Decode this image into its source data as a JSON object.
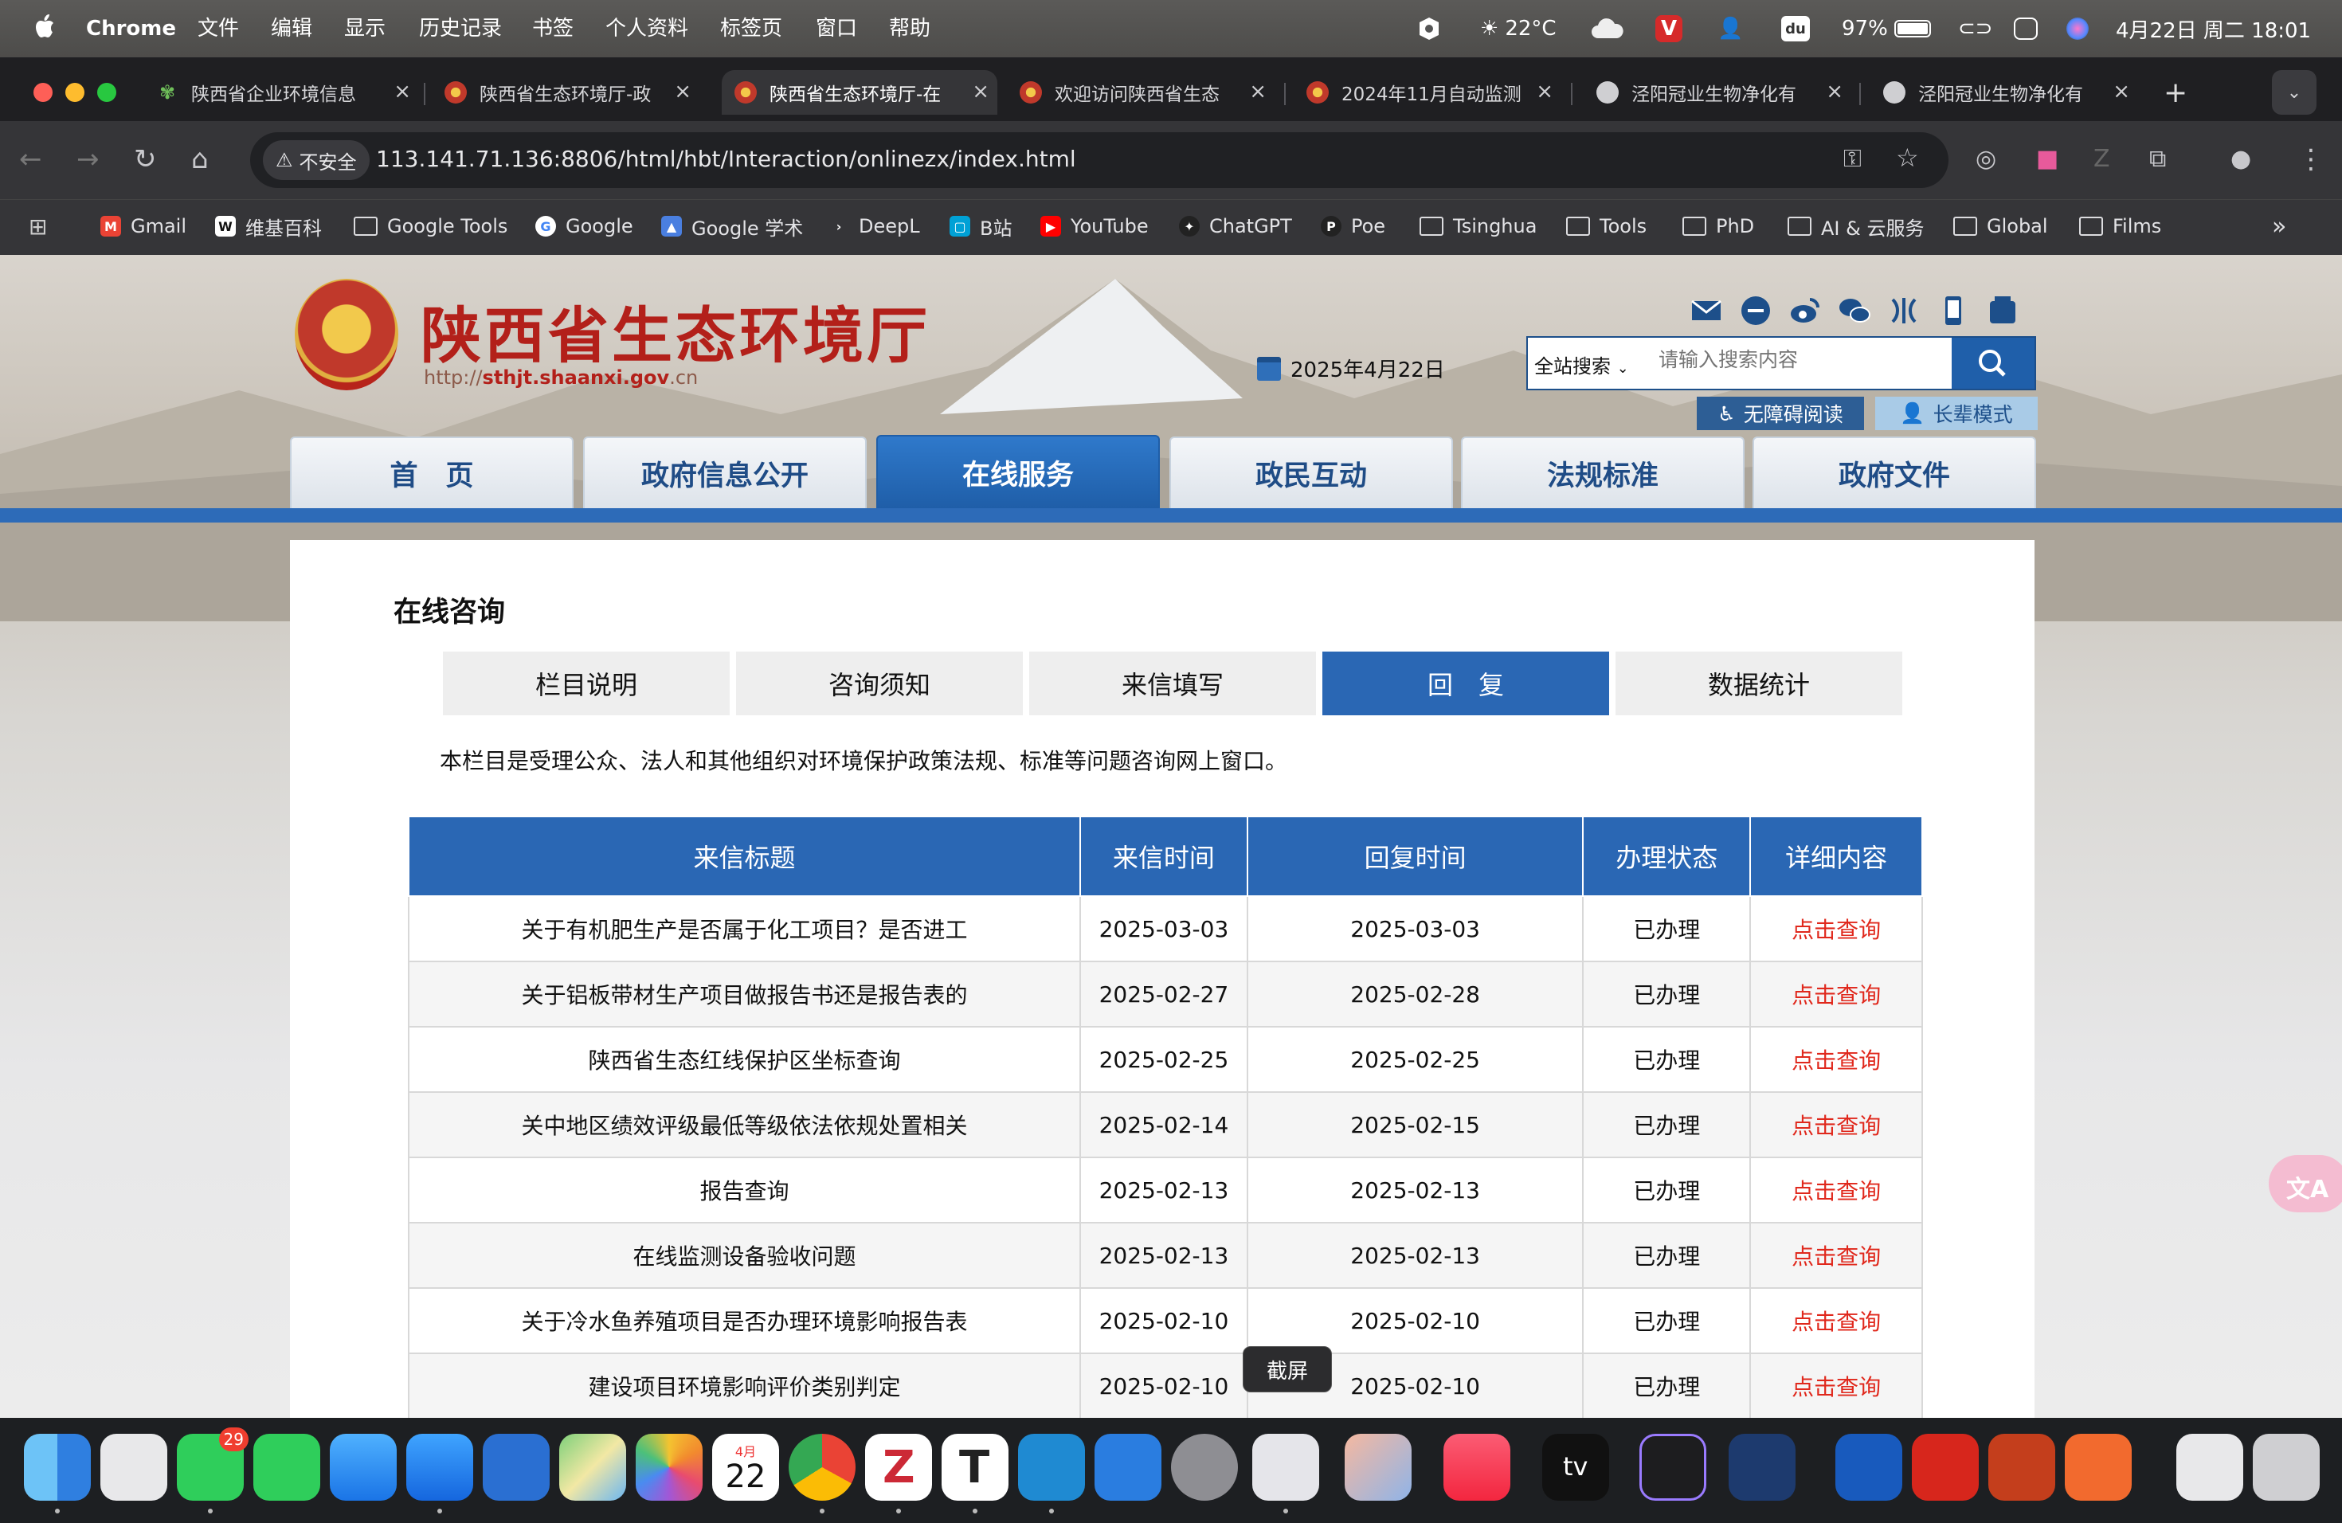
{
  "menubar": {
    "app": "Chrome",
    "items": [
      "文件",
      "编辑",
      "显示",
      "历史记录",
      "书签",
      "个人资料",
      "标签页",
      "窗口",
      "帮助"
    ],
    "weather": "22°C",
    "battery": "97%",
    "clock": "4月22日 周二  18:01"
  },
  "tabs": [
    {
      "label": "陕西省企业环境信息",
      "active": false
    },
    {
      "label": "陕西省生态环境厅-政",
      "active": false
    },
    {
      "label": "陕西省生态环境厅-在",
      "active": true
    },
    {
      "label": "欢迎访问陕西省生态",
      "active": false
    },
    {
      "label": "2024年11月自动监测",
      "active": false
    },
    {
      "label": "泾阳冠业生物净化有",
      "active": false
    },
    {
      "label": "泾阳冠业生物净化有",
      "active": false
    }
  ],
  "omnibox": {
    "security": "不安全",
    "url": "113.141.71.136:8806/html/hbt/Interaction/onlinezx/index.html"
  },
  "bookmarks": [
    "Gmail",
    "维基百科",
    "Google Tools",
    "Google",
    "Google 学术",
    "DeepL",
    "B站",
    "YouTube",
    "ChatGPT",
    "Poe",
    "Tsinghua",
    "Tools",
    "PhD",
    "AI & 云服务",
    "Global",
    "Films"
  ],
  "site": {
    "title": "陕西省生态环境厅",
    "url_prefix": "http://",
    "url_host": "sthjt.shaanxi.gov",
    "url_suffix": ".cn",
    "date": "2025年4月22日",
    "search_scope": "全站搜索",
    "search_placeholder": "请输入搜索内容",
    "accessibility": "无障碍阅读",
    "elder_mode": "长辈模式",
    "nav": [
      "首　页",
      "政府信息公开",
      "在线服务",
      "政民互动",
      "法规标准",
      "政府文件"
    ],
    "active_nav": 2
  },
  "consult": {
    "heading": "在线咨询",
    "subtabs": [
      "栏目说明",
      "咨询须知",
      "来信填写",
      "回　复",
      "数据统计"
    ],
    "active_subtab": 3,
    "description": "本栏目是受理公众、法人和其他组织对环境保护政策法规、标准等问题咨询网上窗口。",
    "columns": [
      "来信标题",
      "来信时间",
      "回复时间",
      "办理状态",
      "详细内容"
    ],
    "rows": [
      {
        "title": "关于有机肥生产是否属于化工项目？是否进工",
        "received": "2025-03-03",
        "replied": "2025-03-03",
        "status": "已办理",
        "link": "点击查询"
      },
      {
        "title": "关于铝板带材生产项目做报告书还是报告表的",
        "received": "2025-02-27",
        "replied": "2025-02-28",
        "status": "已办理",
        "link": "点击查询"
      },
      {
        "title": "陕西省生态红线保护区坐标查询",
        "received": "2025-02-25",
        "replied": "2025-02-25",
        "status": "已办理",
        "link": "点击查询"
      },
      {
        "title": "关中地区绩效评级最低等级依法依规处置相关",
        "received": "2025-02-14",
        "replied": "2025-02-15",
        "status": "已办理",
        "link": "点击查询"
      },
      {
        "title": "报告查询",
        "received": "2025-02-13",
        "replied": "2025-02-13",
        "status": "已办理",
        "link": "点击查询"
      },
      {
        "title": "在线监测设备验收问题",
        "received": "2025-02-13",
        "replied": "2025-02-13",
        "status": "已办理",
        "link": "点击查询"
      },
      {
        "title": "关于冷水鱼养殖项目是否办理环境影响报告表",
        "received": "2025-02-10",
        "replied": "2025-02-10",
        "status": "已办理",
        "link": "点击查询"
      },
      {
        "title": "建设项目环境影响评价类别判定",
        "received": "2025-02-10",
        "replied": "2025-02-10",
        "status": "已办理",
        "link": "点击查询"
      }
    ]
  },
  "tooltip": "截屏",
  "dock": {
    "messages_badge": "29",
    "calendar_month": "4月",
    "calendar_day": "22",
    "tv_label": "tv"
  },
  "colors": {
    "brand_red": "#b3201a",
    "nav_blue": "#2a67b4",
    "link_red": "#e0281c"
  }
}
